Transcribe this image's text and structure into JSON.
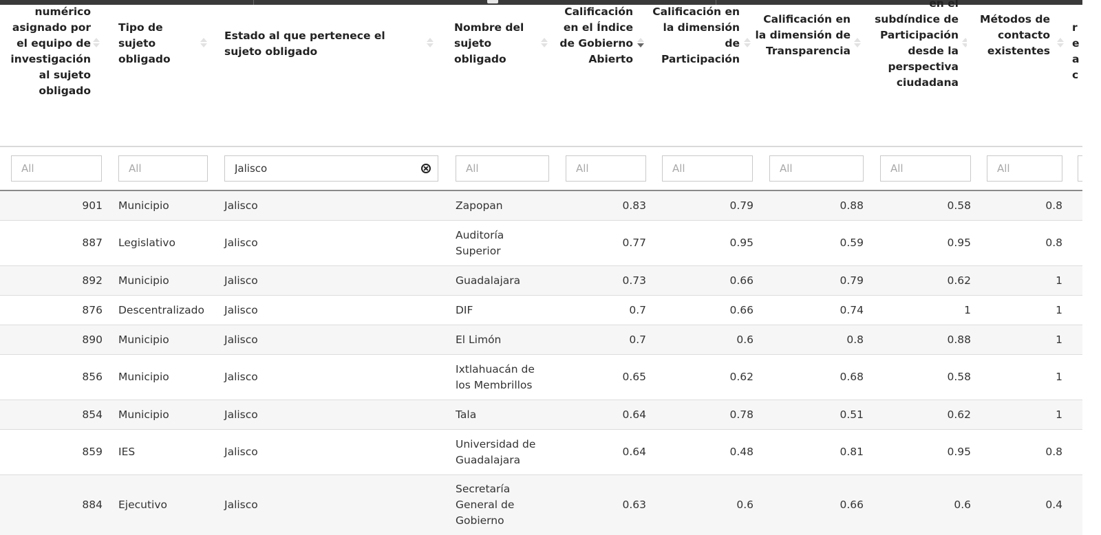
{
  "headers": [
    {
      "label": "numérico asignado por el equipo de investigación al sujeto obligado",
      "sort": "none"
    },
    {
      "label": "Tipo de sujeto obligado",
      "sort": "none"
    },
    {
      "label": "Estado al que pertenece el sujeto obligado",
      "sort": "none"
    },
    {
      "label": "Nombre del sujeto obligado",
      "sort": "none"
    },
    {
      "label": "Calificación en el Índice de Gobierno Abierto",
      "sort": "desc"
    },
    {
      "label": "Calificación en la dimensión de Participación",
      "sort": "none"
    },
    {
      "label": "Calificación en la dimensión de Transparencia",
      "sort": "none"
    },
    {
      "label": "en el subdíndice de Participación desde la perspectiva ciudadana",
      "sort": "none"
    },
    {
      "label": "Métodos de contacto existentes",
      "sort": "none"
    },
    {
      "label": "re a c",
      "sort": "none"
    }
  ],
  "filters": [
    {
      "value": "",
      "placeholder": "All"
    },
    {
      "value": "",
      "placeholder": "All"
    },
    {
      "value": "Jalisco",
      "placeholder": "All"
    },
    {
      "value": "",
      "placeholder": "All"
    },
    {
      "value": "",
      "placeholder": "All"
    },
    {
      "value": "",
      "placeholder": "All"
    },
    {
      "value": "",
      "placeholder": "All"
    },
    {
      "value": "",
      "placeholder": "All"
    },
    {
      "value": "",
      "placeholder": "All"
    },
    {
      "value": "",
      "placeholder": ""
    }
  ],
  "rows": [
    {
      "id": "901",
      "tipo": "Municipio",
      "estado": "Jalisco",
      "nombre": "Zapopan",
      "iga": "0.83",
      "participacion": "0.79",
      "transparencia": "0.88",
      "subindice": "0.58",
      "metodos": "0.8"
    },
    {
      "id": "887",
      "tipo": "Legislativo",
      "estado": "Jalisco",
      "nombre": "Auditoría Superior",
      "iga": "0.77",
      "participacion": "0.95",
      "transparencia": "0.59",
      "subindice": "0.95",
      "metodos": "0.8"
    },
    {
      "id": "892",
      "tipo": "Municipio",
      "estado": "Jalisco",
      "nombre": "Guadalajara",
      "iga": "0.73",
      "participacion": "0.66",
      "transparencia": "0.79",
      "subindice": "0.62",
      "metodos": "1"
    },
    {
      "id": "876",
      "tipo": "Descentralizado",
      "estado": "Jalisco",
      "nombre": "DIF",
      "iga": "0.7",
      "participacion": "0.66",
      "transparencia": "0.74",
      "subindice": "1",
      "metodos": "1"
    },
    {
      "id": "890",
      "tipo": "Municipio",
      "estado": "Jalisco",
      "nombre": "El Limón",
      "iga": "0.7",
      "participacion": "0.6",
      "transparencia": "0.8",
      "subindice": "0.88",
      "metodos": "1"
    },
    {
      "id": "856",
      "tipo": "Municipio",
      "estado": "Jalisco",
      "nombre": "Ixtlahuacán de los Membrillos",
      "iga": "0.65",
      "participacion": "0.62",
      "transparencia": "0.68",
      "subindice": "0.58",
      "metodos": "1"
    },
    {
      "id": "854",
      "tipo": "Municipio",
      "estado": "Jalisco",
      "nombre": "Tala",
      "iga": "0.64",
      "participacion": "0.78",
      "transparencia": "0.51",
      "subindice": "0.62",
      "metodos": "1"
    },
    {
      "id": "859",
      "tipo": "IES",
      "estado": "Jalisco",
      "nombre": "Universidad de Guadalajara",
      "iga": "0.64",
      "participacion": "0.48",
      "transparencia": "0.81",
      "subindice": "0.95",
      "metodos": "0.8"
    },
    {
      "id": "884",
      "tipo": "Ejecutivo",
      "estado": "Jalisco",
      "nombre": "Secretaría General de Gobierno",
      "iga": "0.63",
      "participacion": "0.6",
      "transparencia": "0.66",
      "subindice": "0.6",
      "metodos": "0.4"
    }
  ]
}
